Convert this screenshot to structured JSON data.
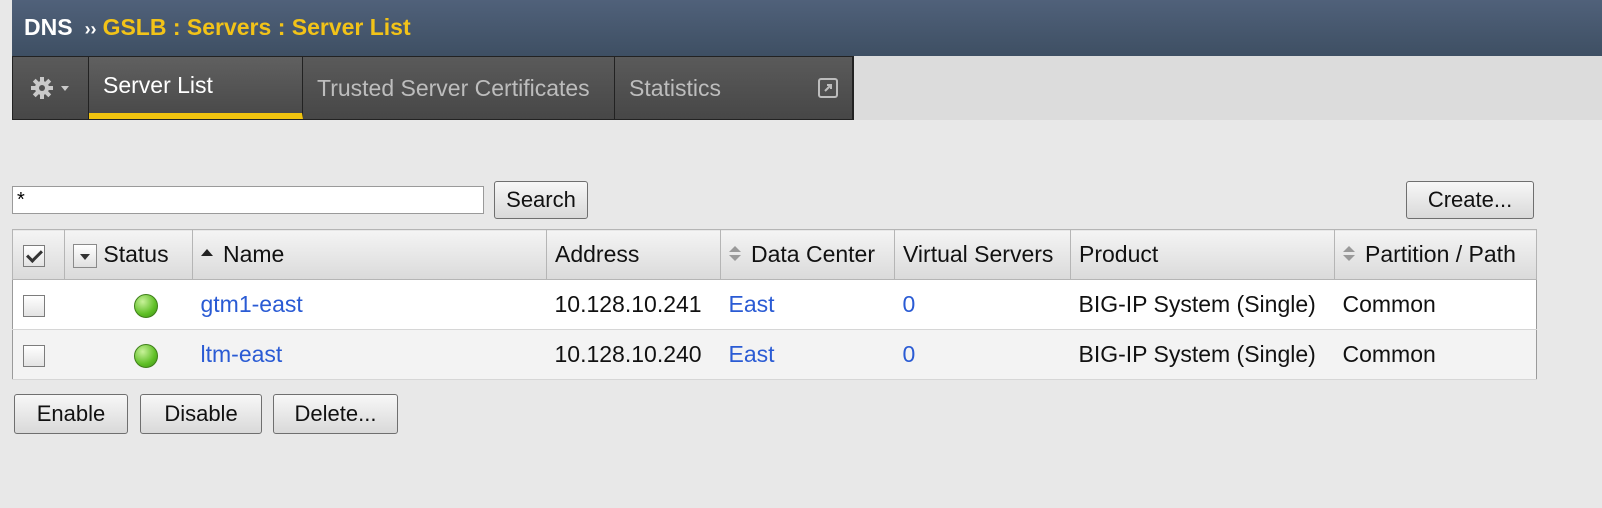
{
  "breadcrumb": {
    "root": "DNS",
    "separator": "››",
    "path": "GSLB : Servers : Server List"
  },
  "tabs": [
    {
      "label": "Server List",
      "active": true
    },
    {
      "label": "Trusted Server Certificates",
      "active": false
    },
    {
      "label": "Statistics",
      "active": false
    }
  ],
  "icons": {
    "menu": "gear-icon",
    "external": "external-link-icon"
  },
  "colors": {
    "header_bg": "#46576c",
    "breadcrumb_path": "#f2c318",
    "active_tab_underline": "#f1c40f",
    "link": "#2a5bd4",
    "status_available": "#5fbf26"
  },
  "search": {
    "value": "*",
    "button_label": "Search"
  },
  "create_label": "Create...",
  "table": {
    "columns": {
      "status": "Status",
      "name": "Name",
      "address": "Address",
      "data_center": "Data Center",
      "virtual_servers": "Virtual Servers",
      "product": "Product",
      "partition": "Partition / Path"
    },
    "rows": [
      {
        "name": "gtm1-east",
        "address": "10.128.10.241",
        "data_center": "East",
        "virtual_servers": "0",
        "product": "BIG-IP System (Single)",
        "partition": "Common",
        "status": "available"
      },
      {
        "name": "ltm-east",
        "address": "10.128.10.240",
        "data_center": "East",
        "virtual_servers": "0",
        "product": "BIG-IP System (Single)",
        "partition": "Common",
        "status": "available"
      }
    ]
  },
  "actions": {
    "enable": "Enable",
    "disable": "Disable",
    "delete": "Delete..."
  }
}
